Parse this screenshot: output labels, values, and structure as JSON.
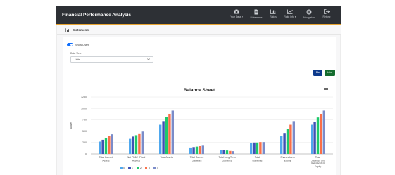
{
  "app": {
    "title": "Financial Performance Analysis"
  },
  "nav": {
    "items": [
      {
        "label": "Your Data ▾",
        "icon": "camera-icon"
      },
      {
        "label": "Statements",
        "icon": "document-icon"
      },
      {
        "label": "Ratios",
        "icon": "bar-chart-icon"
      },
      {
        "label": "Ratio Info ▾",
        "icon": "line-chart-icon"
      },
      {
        "label": "Navigation",
        "icon": "gear-icon"
      },
      {
        "label": "Retune",
        "icon": "exit-icon"
      }
    ]
  },
  "section": {
    "title": "Statements"
  },
  "controls": {
    "toggle_label": "Show Chart",
    "field_label": "Data View",
    "select_value": "Units",
    "bar_button": "Bar",
    "line_button": "Line"
  },
  "colors": {
    "navbar": "#2d3035",
    "accent": "#e7a32f",
    "series": [
      "#4fa8ee",
      "#3f51b5",
      "#1ec96b",
      "#fa6f48",
      "#7b8cc9"
    ]
  },
  "chart_data": {
    "type": "bar",
    "title": "Balance Sheet",
    "ylabel": "Values",
    "xlabel": "",
    "ylim": [
      0,
      1250
    ],
    "yticks": [
      0,
      250,
      500,
      750,
      1000,
      1250
    ],
    "grid": true,
    "legend_position": "bottom",
    "categories": [
      "Total Current Assets",
      "Net PP&E (Fixed Assets)",
      "Total Assets",
      "Total Current Liabilities",
      "Total Long Term Liabilities",
      "Total Liabilities",
      "Shareholders Equity",
      "Total Liabilities and Shareholders Equity"
    ],
    "series": [
      {
        "name": "0",
        "values": [
          270,
          330,
          640,
          140,
          90,
          240,
          390,
          640
        ]
      },
      {
        "name": "1",
        "values": [
          310,
          380,
          720,
          150,
          80,
          250,
          460,
          710
        ]
      },
      {
        "name": "2",
        "values": [
          350,
          410,
          810,
          160,
          75,
          250,
          540,
          800
        ]
      },
      {
        "name": "3",
        "values": [
          390,
          450,
          880,
          170,
          65,
          260,
          640,
          880
        ]
      },
      {
        "name": "4",
        "values": [
          430,
          490,
          950,
          180,
          60,
          260,
          720,
          950
        ]
      }
    ]
  }
}
